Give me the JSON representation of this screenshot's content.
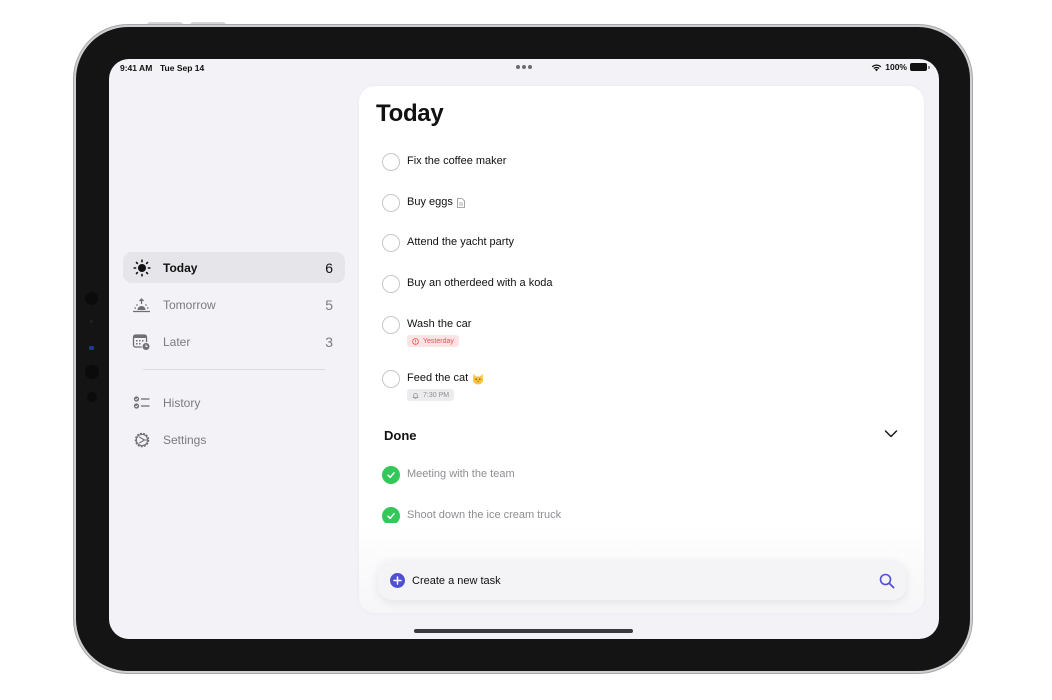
{
  "status_bar": {
    "time": "9:41 AM",
    "date": "Tue Sep 14",
    "battery": "100%",
    "icons": [
      "wifi-icon",
      "battery-icon",
      "multitasking-dots-icon"
    ]
  },
  "sidebar": {
    "items": [
      {
        "label": "Today",
        "count": "6",
        "icon": "sun-icon",
        "active": true
      },
      {
        "label": "Tomorrow",
        "count": "5",
        "icon": "sunrise-icon",
        "active": false
      },
      {
        "label": "Later",
        "count": "3",
        "icon": "calendar-clock-icon",
        "active": false
      }
    ],
    "secondary": [
      {
        "label": "History",
        "icon": "checklist-icon"
      },
      {
        "label": "Settings",
        "icon": "gear-icon"
      }
    ]
  },
  "main": {
    "title": "Today",
    "tasks": [
      {
        "text": "Fix the coffee maker"
      },
      {
        "text": "Buy eggs",
        "icon": "note-icon"
      },
      {
        "text": "Attend the yacht party"
      },
      {
        "text": "Buy an otherdeed with a koda"
      },
      {
        "text": "Wash the car",
        "badge": {
          "text": "Yesterday",
          "icon": "overdue-clock-icon",
          "color": "#ef4d55"
        }
      },
      {
        "text": "Feed the cat",
        "emoji": "cat-emoji",
        "badge": {
          "text": "7:30 PM",
          "icon": "bell-icon",
          "color": "#8e8e93"
        }
      }
    ],
    "done_section": {
      "heading": "Done",
      "expanded": true,
      "tasks": [
        {
          "text": "Meeting with the team"
        },
        {
          "text": "Shoot down the ice cream truck"
        }
      ]
    },
    "create_bar": {
      "label": "Create a new task",
      "accent": "#4f4fd6"
    }
  },
  "colors": {
    "accent": "#4f4fd6",
    "done_green": "#34c759",
    "overdue_red": "#ef4d55",
    "sidebar_bg": "#f2f2f7"
  }
}
